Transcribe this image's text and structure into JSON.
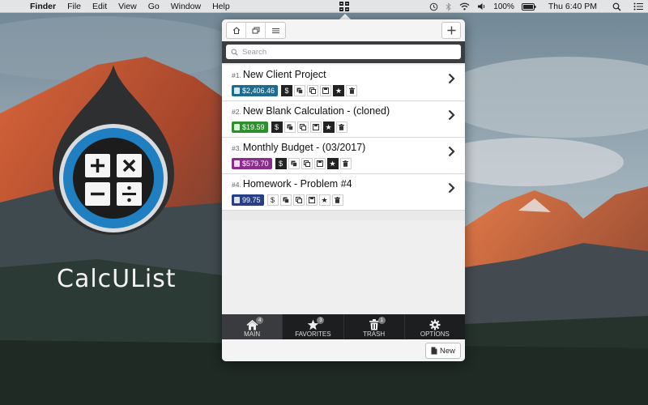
{
  "menubar": {
    "items": [
      "Finder",
      "File",
      "Edit",
      "View",
      "Go",
      "Window",
      "Help"
    ],
    "battery": "100%",
    "clock": "Thu 6:40 PM"
  },
  "logo": {
    "title": "CalcUList"
  },
  "toolbar": {
    "buttons": [
      {
        "icon": "home-icon"
      },
      {
        "icon": "window-icon"
      },
      {
        "icon": "list-icon"
      }
    ],
    "add_icon": "plus-icon"
  },
  "search": {
    "placeholder": "Search"
  },
  "items": [
    {
      "num": "#1.",
      "name": "New Client Project",
      "amount": "$2,406.46",
      "color": "#1d6c8f",
      "favorite": true
    },
    {
      "num": "#2.",
      "name": "New Blank Calculation - (cloned)",
      "amount": "$19.59",
      "color": "#2f8f2f",
      "favorite": true
    },
    {
      "num": "#3.",
      "name": "Monthly Budget - (03/2017)",
      "amount": "$579.70",
      "color": "#8e2b8e",
      "favorite": true
    },
    {
      "num": "#4.",
      "name": "Homework - Problem #4",
      "amount": "99.75",
      "color": "#283f86",
      "favorite": false
    }
  ],
  "tabs": [
    {
      "label": "MAIN",
      "badge": "4",
      "icon": "home-icon",
      "active": true
    },
    {
      "label": "FAVORITES",
      "badge": "3",
      "icon": "star-icon",
      "active": false
    },
    {
      "label": "TRASH",
      "badge": "1",
      "icon": "trash-icon",
      "active": false
    },
    {
      "label": "OPTIONS",
      "badge": "",
      "icon": "gear-icon",
      "active": false
    }
  ],
  "footer": {
    "new_label": "New"
  }
}
